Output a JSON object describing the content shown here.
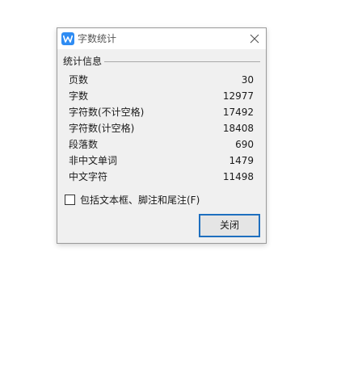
{
  "window": {
    "title": "字数统计",
    "icon": "wps-writer-icon",
    "close_icon": "close-icon"
  },
  "group": {
    "label": "统计信息"
  },
  "stats": [
    {
      "label": "页数",
      "value": "30"
    },
    {
      "label": "字数",
      "value": "12977"
    },
    {
      "label": "字符数(不计空格)",
      "value": "17492"
    },
    {
      "label": "字符数(计空格)",
      "value": "18408"
    },
    {
      "label": "段落数",
      "value": "690"
    },
    {
      "label": "非中文单词",
      "value": "1479"
    },
    {
      "label": "中文字符",
      "value": "11498"
    }
  ],
  "checkbox": {
    "label": "包括文本框、脚注和尾注(F)",
    "checked": false
  },
  "buttons": {
    "close_label": "关闭"
  },
  "colors": {
    "accent": "#1e6fbf",
    "icon_bg": "#2f8cf3"
  }
}
